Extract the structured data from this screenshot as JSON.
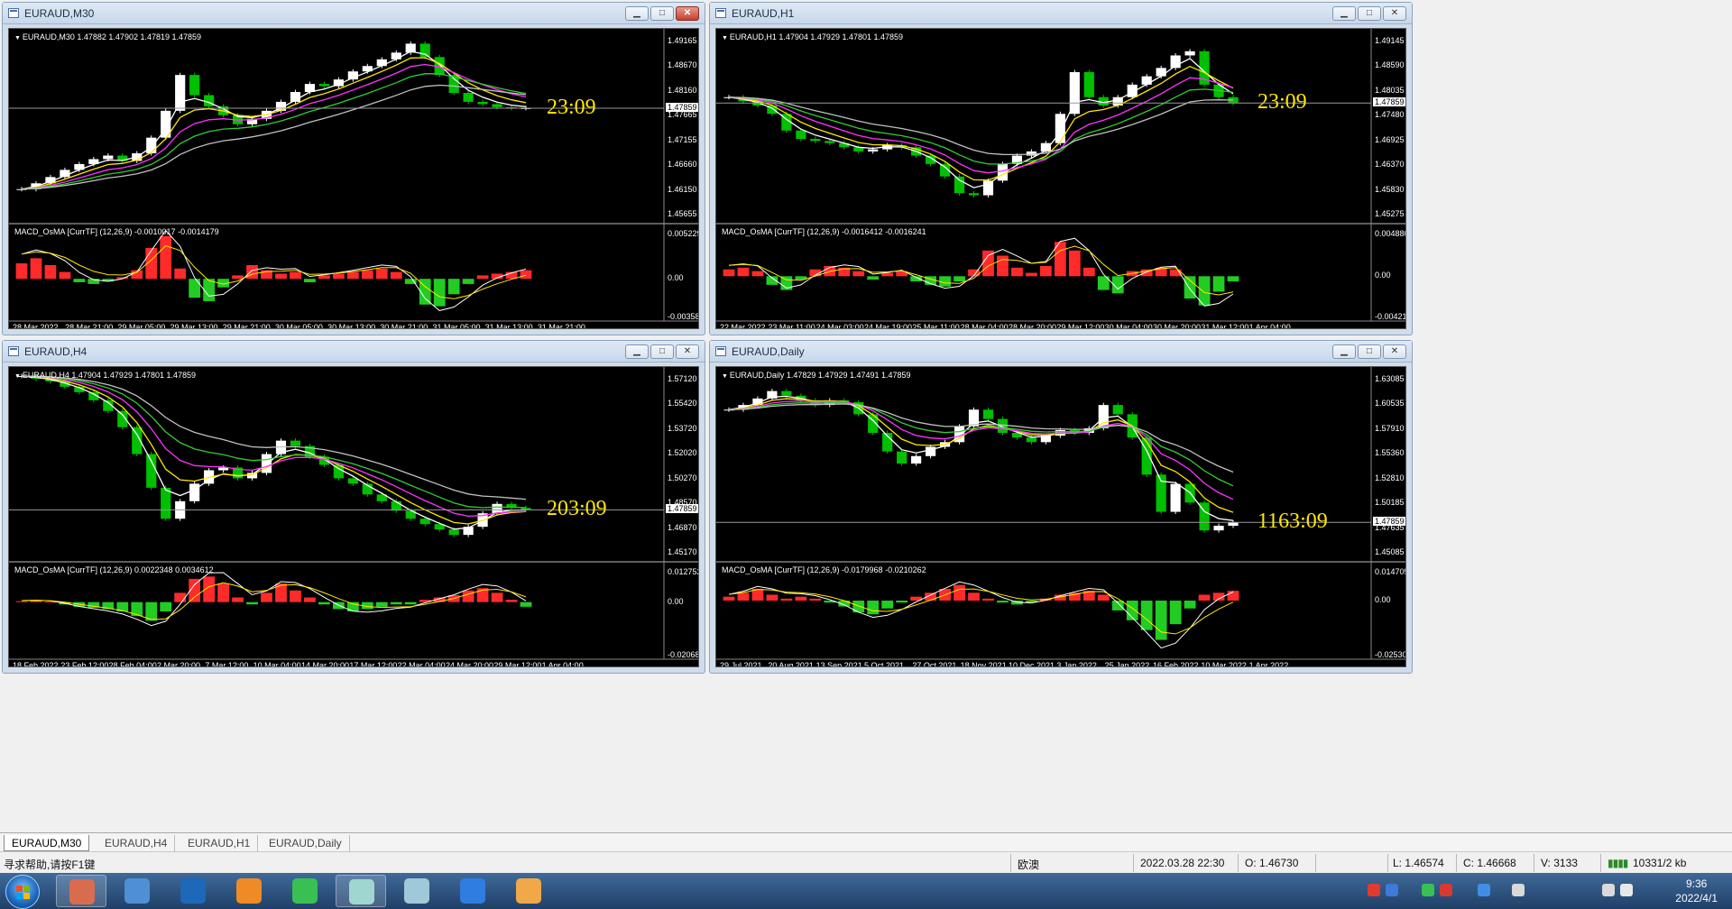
{
  "windows": [
    {
      "id": "m30",
      "title": "EURAUD,M30",
      "symbol_line": "EURAUD,M30  1.47882 1.47902 1.47819 1.47859",
      "macd_line": "MACD_OsMA [CurrTF] (12,26,9) -0.0010017 -0.0014179",
      "timer": "23:09",
      "current_price": "1.47859",
      "price_ticks": [
        "1.49165",
        "1.48670",
        "1.48160",
        "1.47665",
        "1.47155",
        "1.46660",
        "1.46150",
        "1.45655"
      ],
      "macd_ticks": [
        "0.0052294",
        "0.00",
        "-0.003583"
      ],
      "time_ticks": [
        "28 Mar 2022",
        "28 Mar 21:00",
        "29 Mar 05:00",
        "29 Mar 13:00",
        "29 Mar 21:00",
        "30 Mar 05:00",
        "30 Mar 13:00",
        "30 Mar 21:00",
        "31 Mar 05:00",
        "31 Mar 13:00",
        "31 Mar 21:00"
      ],
      "price_range": [
        1.454,
        1.4955
      ],
      "macd_range": [
        -0.0045,
        0.0058
      ],
      "price_path": [
        1.4605,
        1.4618,
        1.4632,
        1.4648,
        1.4661,
        1.4672,
        1.468,
        1.4668,
        1.4685,
        1.472,
        1.478,
        1.486,
        1.4815,
        1.479,
        1.477,
        1.475,
        1.4762,
        1.478,
        1.48,
        1.4822,
        1.484,
        1.4835,
        1.485,
        1.4868,
        1.488,
        1.4895,
        1.491,
        1.493,
        1.49,
        1.486,
        1.482,
        1.48,
        1.4795,
        1.4788,
        1.4786,
        1.4786
      ],
      "macd_hist": [
        0.0018,
        0.0024,
        0.0016,
        0.0008,
        -0.0004,
        -0.0006,
        -0.0003,
        0.0002,
        0.001,
        0.0036,
        0.005,
        0.0012,
        -0.0022,
        -0.0026,
        -0.001,
        0.0004,
        0.0016,
        0.001,
        0.0006,
        0.0008,
        -0.0004,
        0.0004,
        0.0006,
        0.0008,
        0.001,
        0.0012,
        0.0008,
        -0.0006,
        -0.003,
        -0.0032,
        -0.0018,
        -0.0006,
        0.0004,
        0.0006,
        0.0008,
        0.001
      ]
    },
    {
      "id": "h1",
      "title": "EURAUD,H1",
      "symbol_line": "EURAUD,H1  1.47904 1.47929 1.47801 1.47859",
      "macd_line": "MACD_OsMA [CurrTF] (12,26,9) -0.0016412 -0.0016241",
      "timer": "23:09",
      "current_price": "1.47859",
      "price_ticks": [
        "1.49145",
        "1.48590",
        "1.48035",
        "1.47480",
        "1.46925",
        "1.46370",
        "1.45830",
        "1.45275"
      ],
      "macd_ticks": [
        "0.0048803",
        "0.00",
        "-0.004212"
      ],
      "time_ticks": [
        "22 Mar 2022",
        "23 Mar 11:00",
        "24 Mar 03:00",
        "24 Mar 19:00",
        "25 Mar 11:00",
        "28 Mar 04:00",
        "28 Mar 20:00",
        "29 Mar 12:00",
        "30 Mar 04:00",
        "30 Mar 20:00",
        "31 Mar 12:00",
        "1 Apr 04:00"
      ],
      "price_range": [
        1.451,
        1.4955
      ],
      "macd_range": [
        -0.0048,
        0.0055
      ],
      "price_path": [
        1.48,
        1.479,
        1.478,
        1.476,
        1.472,
        1.47,
        1.4695,
        1.469,
        1.468,
        1.467,
        1.4675,
        1.4685,
        1.468,
        1.466,
        1.464,
        1.461,
        1.457,
        1.4565,
        1.46,
        1.464,
        1.466,
        1.467,
        1.469,
        1.476,
        1.486,
        1.48,
        1.478,
        1.48,
        1.483,
        1.485,
        1.487,
        1.49,
        1.491,
        1.483,
        1.48,
        1.4786
      ],
      "macd_hist": [
        0.0008,
        0.001,
        0.0006,
        -0.001,
        -0.0016,
        -0.0004,
        0.0008,
        0.0012,
        0.001,
        0.0006,
        -0.0004,
        0.0004,
        0.0006,
        -0.0006,
        -0.001,
        -0.0012,
        -0.0006,
        0.0008,
        0.003,
        0.0024,
        0.001,
        0.0004,
        0.0012,
        0.004,
        0.003,
        0.001,
        -0.0016,
        -0.002,
        0.0006,
        0.0008,
        0.001,
        0.0008,
        -0.0026,
        -0.0034,
        -0.0018,
        -0.0006
      ]
    },
    {
      "id": "h4",
      "title": "EURAUD,H4",
      "symbol_line": "EURAUD,H4  1.47904 1.47929 1.47801 1.47859",
      "macd_line": "MACD_OsMA [CurrTF] (12,26,9) 0.0022348 0.0034612",
      "timer": "203:09",
      "current_price": "1.47859",
      "price_ticks": [
        "1.57120",
        "1.55420",
        "1.53720",
        "1.52020",
        "1.50270",
        "1.48570",
        "1.46870",
        "1.45170"
      ],
      "macd_ticks": [
        "0.012752",
        "0.00",
        "-0.020687"
      ],
      "time_ticks": [
        "18 Feb 2022",
        "23 Feb 12:00",
        "28 Feb 04:00",
        "2 Mar 20:00",
        "7 Mar 12:00",
        "10 Mar 04:00",
        "14 Mar 20:00",
        "17 Mar 12:00",
        "22 Mar 04:00",
        "24 Mar 20:00",
        "29 Mar 12:00",
        "1 Apr 04:00"
      ],
      "price_range": [
        1.444,
        1.582
      ],
      "macd_range": [
        -0.023,
        0.015
      ],
      "price_path": [
        1.578,
        1.576,
        1.574,
        1.57,
        1.566,
        1.56,
        1.552,
        1.54,
        1.52,
        1.495,
        1.472,
        1.485,
        1.498,
        1.508,
        1.51,
        1.502,
        1.506,
        1.52,
        1.53,
        1.526,
        1.518,
        1.512,
        1.502,
        1.498,
        1.49,
        1.485,
        1.478,
        1.472,
        1.468,
        1.464,
        1.46,
        1.466,
        1.476,
        1.483,
        1.48,
        1.4786
      ],
      "macd_hist": [
        0.0004,
        0.0006,
        0.0002,
        -0.001,
        -0.002,
        -0.0024,
        -0.003,
        -0.004,
        -0.006,
        -0.008,
        -0.004,
        0.004,
        0.01,
        0.011,
        0.008,
        0.002,
        -0.001,
        0.004,
        0.008,
        0.005,
        0.002,
        -0.001,
        -0.003,
        -0.004,
        -0.003,
        -0.002,
        -0.001,
        -0.001,
        0.001,
        0.002,
        0.003,
        0.005,
        0.006,
        0.004,
        0.001,
        -0.002
      ]
    },
    {
      "id": "daily",
      "title": "EURAUD,Daily",
      "symbol_line": "EURAUD,Daily  1.47829 1.47929 1.47491 1.47859",
      "macd_line": "MACD_OsMA [CurrTF] (12,26,9) -0.0179968 -0.0210262",
      "timer": "1163:09",
      "current_price": "1.47859",
      "price_ticks": [
        "1.63085",
        "1.60535",
        "1.57910",
        "1.55360",
        "1.52810",
        "1.50185",
        "1.47635",
        "1.45085"
      ],
      "macd_ticks": [
        "0.0147054",
        "0.00",
        "-0.025307"
      ],
      "time_ticks": [
        "29 Jul 2021",
        "20 Aug 2021",
        "13 Sep 2021",
        "5 Oct 2021",
        "27 Oct 2021",
        "18 Nov 2021",
        "10 Dec 2021",
        "3 Jan 2022",
        "25 Jan 2022",
        "16 Feb 2022",
        "10 Mar 2022",
        "1 Apr 2022"
      ],
      "price_range": [
        1.442,
        1.642
      ],
      "macd_range": [
        -0.028,
        0.017
      ],
      "price_path": [
        1.6,
        1.605,
        1.612,
        1.62,
        1.615,
        1.61,
        1.605,
        1.61,
        1.608,
        1.595,
        1.575,
        1.555,
        1.542,
        1.55,
        1.56,
        1.565,
        1.582,
        1.6,
        1.59,
        1.575,
        1.57,
        1.565,
        1.572,
        1.578,
        1.575,
        1.58,
        1.605,
        1.595,
        1.57,
        1.53,
        1.49,
        1.52,
        1.5,
        1.47,
        1.475,
        1.4786
      ],
      "macd_hist": [
        0.002,
        0.004,
        0.006,
        0.003,
        0.001,
        0.002,
        0.001,
        -0.001,
        -0.003,
        -0.006,
        -0.007,
        -0.004,
        -0.001,
        0.002,
        0.004,
        0.006,
        0.008,
        0.004,
        0.001,
        -0.001,
        -0.002,
        -0.001,
        0.001,
        0.003,
        0.004,
        0.005,
        0.003,
        -0.005,
        -0.01,
        -0.015,
        -0.02,
        -0.012,
        -0.004,
        0.003,
        0.004,
        0.005
      ]
    }
  ],
  "tabs": [
    "EURAUD,M30",
    "EURAUD,H4",
    "EURAUD,H1",
    "EURAUD,Daily"
  ],
  "active_tab": 0,
  "status": {
    "help": "寻求帮助,请按F1键",
    "profile": "欧澳",
    "datetime": "2022.03.28 22:30",
    "open": "O: 1.46730",
    "low": "L: 1.46574",
    "close": "C: 1.46668",
    "volume": "V: 3133",
    "traffic": "10331/2 kb"
  },
  "taskbar": {
    "time": "9:36",
    "date": "2022/4/1",
    "apps": [
      "paint-icon",
      "network-icon",
      "desktop-icon",
      "media-icon",
      "wechat-icon",
      "mt4-icon",
      "glass-icon",
      "feather-icon",
      "wps-icon"
    ]
  },
  "colors": {
    "bull": "#ffffff",
    "bear": "#00c000",
    "ma_yellow": "#ffe800",
    "ma_white": "#ffffff",
    "ma_magenta": "#ff33ff",
    "ma_green": "#33cc33",
    "ma_gray": "#c0c0c0",
    "hist_up": "#ff2a2a",
    "hist_down": "#22cc22"
  }
}
